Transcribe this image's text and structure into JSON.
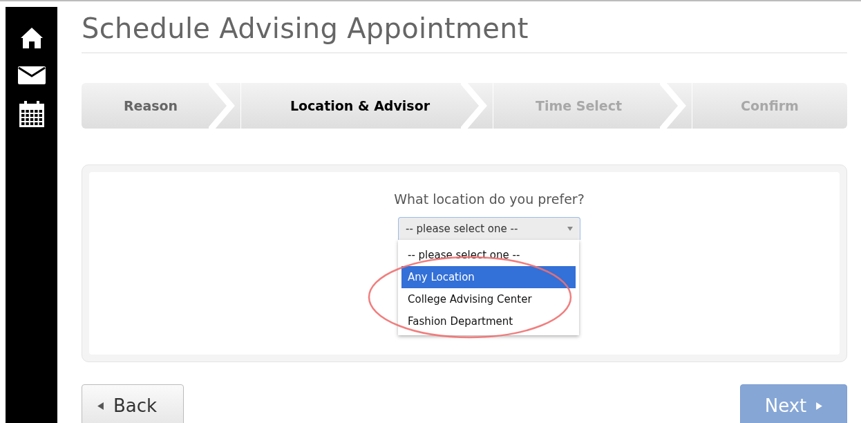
{
  "title": "Schedule Advising Appointment",
  "steps": [
    {
      "label": "Reason",
      "kind": "done",
      "selected": false
    },
    {
      "label": "Location & Advisor",
      "kind": "current",
      "selected": true
    },
    {
      "label": "Time Select",
      "kind": "upcoming",
      "selected": false
    },
    {
      "label": "Confirm",
      "kind": "upcoming",
      "selected": false
    }
  ],
  "question": "What location do you prefer?",
  "location_select": {
    "value": "-- please select one --",
    "expanded": true,
    "options": [
      {
        "label": "-- please select one --",
        "highlighted": false
      },
      {
        "label": "Any Location",
        "highlighted": true
      },
      {
        "label": "College Advising Center",
        "highlighted": false
      },
      {
        "label": "Fashion Department",
        "highlighted": false
      }
    ]
  },
  "back_button": {
    "label": "Back",
    "disabled": false
  },
  "next_button": {
    "label": "Next",
    "disabled": true
  }
}
